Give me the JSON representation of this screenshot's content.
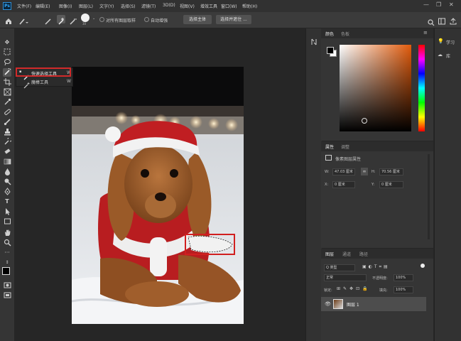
{
  "app": {
    "logo": "Ps"
  },
  "menu": [
    "文件(F)",
    "编辑(E)",
    "图像(I)",
    "图层(L)",
    "文字(Y)",
    "选择(S)",
    "滤镜(T)",
    "3D(D)",
    "视图(V)",
    "增效工具",
    "窗口(W)",
    "帮助(H)"
  ],
  "window_controls": {
    "minimize": "—",
    "restore": "❐",
    "close": "✕"
  },
  "options": {
    "brush_size": "30",
    "sample_all_layers": "对所有图层取样",
    "auto_enhance": "自动增强",
    "select_subject": "选择主体",
    "select_and_mask": "选择并遮住 ..."
  },
  "tool_flyout": [
    {
      "label": "快速选择工具",
      "shortcut": "W"
    },
    {
      "label": "魔棒工具",
      "shortcut": "W"
    }
  ],
  "color_panel": {
    "tabs": [
      "颜色",
      "色板"
    ],
    "foreground": "#000000",
    "background": "#ffffff"
  },
  "properties_panel": {
    "tabs": [
      "属性",
      "调整"
    ],
    "layer_type": "像素图层属性",
    "w_label": "W:",
    "w_value": "47.03 厘米",
    "h_label": "H:",
    "h_value": "70.56 厘米",
    "x_label": "X:",
    "x_value": "0 厘米",
    "y_label": "Y:",
    "y_value": "0 厘米",
    "link_icon": "∞"
  },
  "layers_panel": {
    "tabs": [
      "图层",
      "通道",
      "路径"
    ],
    "filter_kind": "Q 类型",
    "blend_mode": "正常",
    "opacity_label": "不透明度:",
    "opacity_value": "100%",
    "lock_label": "锁定:",
    "fill_label": "填充:",
    "fill_value": "100%",
    "layer_name": "图层 1"
  },
  "learn_panel": {
    "learn": "学习",
    "libraries": "库"
  }
}
